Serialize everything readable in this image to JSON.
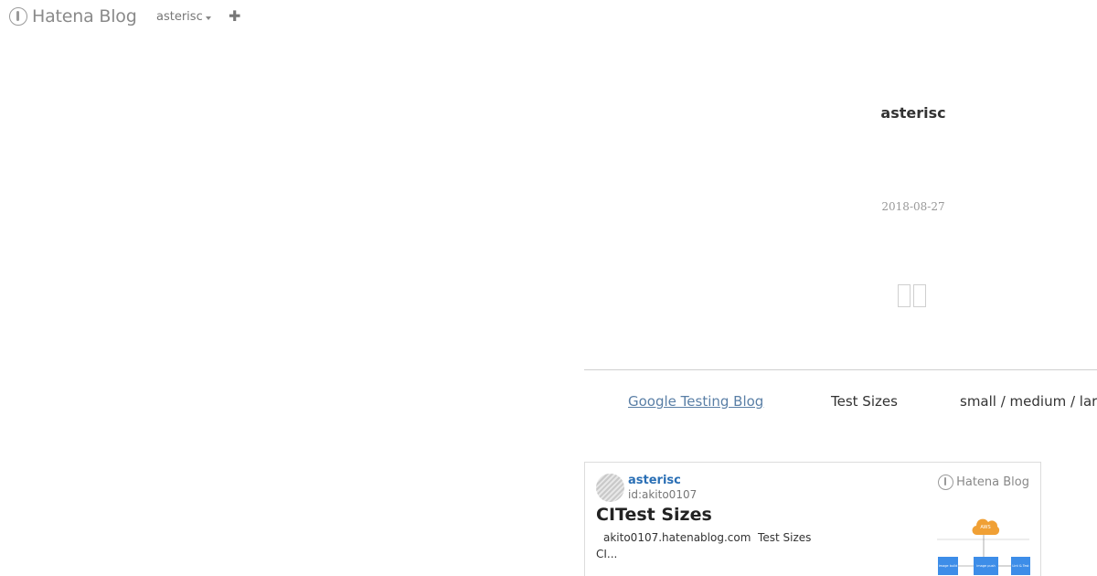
{
  "topbar": {
    "logo_text": "Hatena Blog",
    "blog_name": "asterisc",
    "add_icon": "plus-icon"
  },
  "entry": {
    "blog_title": "asterisc",
    "date": "2018-08-27"
  },
  "links_row": {
    "link_text": "Google Testing Blog",
    "item_2": "Test Sizes",
    "item_3": "small / medium / large"
  },
  "embed_card": {
    "author": "asterisc",
    "user_id": "id:akito0107",
    "title": "CITest Sizes",
    "domain": "akito0107.hatenablog.com",
    "excerpt_tail": "Test Sizes",
    "excerpt_line2": "CI...",
    "brand": "Hatena Blog",
    "thumb_badge": "AWS",
    "thumb_labels": [
      "image build",
      "image push",
      "Lint & Test"
    ],
    "accent_color": "#2a6fb5"
  }
}
